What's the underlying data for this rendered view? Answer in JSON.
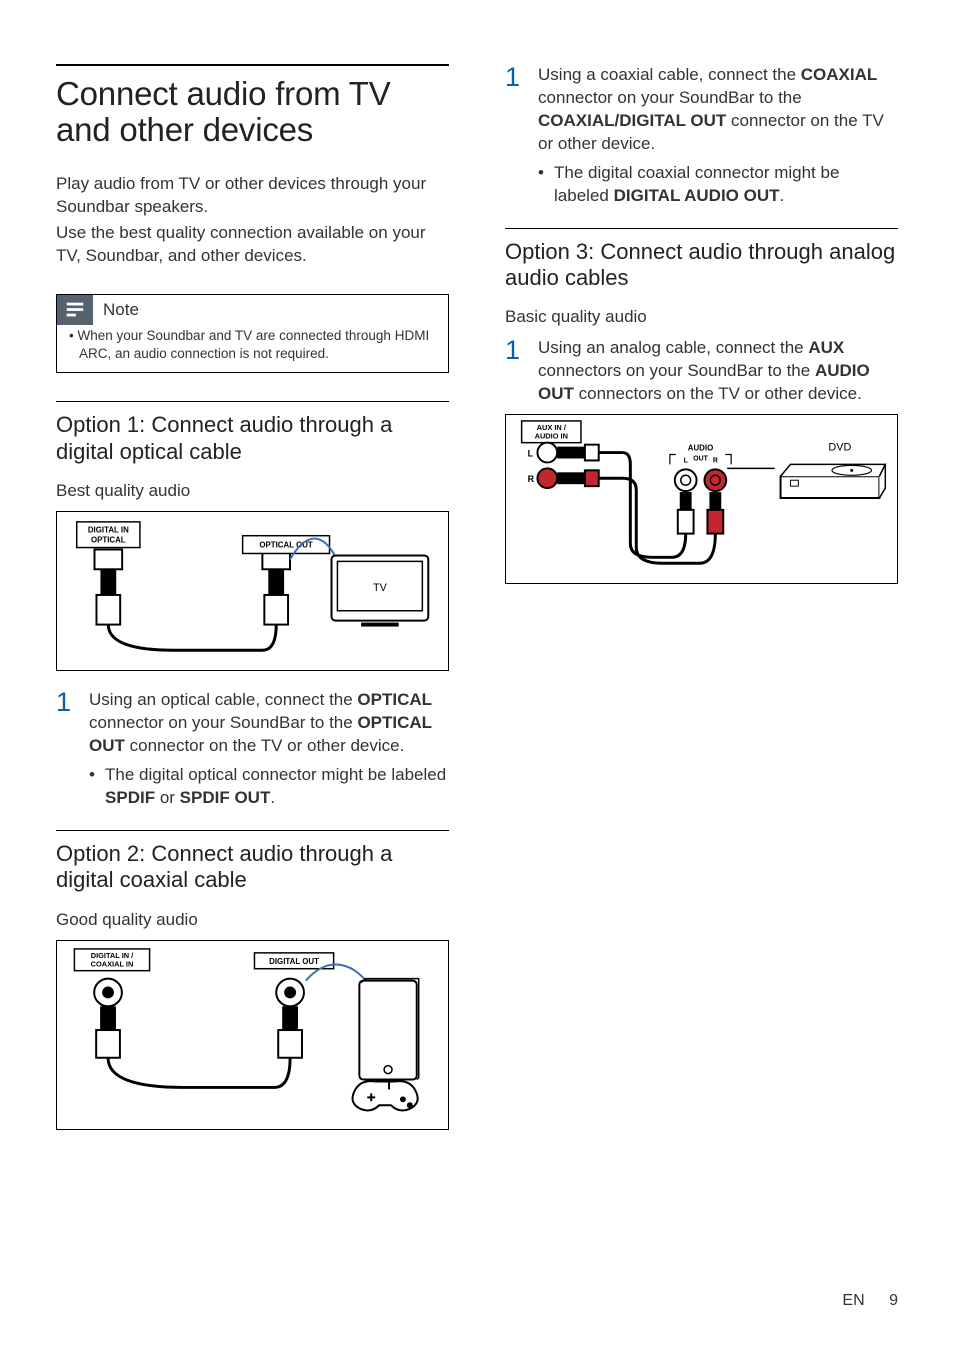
{
  "left": {
    "title": "Connect audio from TV and other devices",
    "intro1": "Play audio from TV or other devices through your Soundbar speakers.",
    "intro2": "Use the best quality connection available on your TV, Soundbar, and other devices.",
    "note": {
      "label": "Note",
      "item": "When your Soundbar and TV are connected through HDMI ARC, an audio connection is not required."
    },
    "opt1": {
      "heading": "Option 1: Connect audio through a digital optical cable",
      "quality": "Best quality audio",
      "diagram": {
        "label_in": "DIGITAL IN OPTICAL",
        "label_out": "OPTICAL OUT",
        "device": "TV"
      },
      "step1_a": "Using an optical cable, connect the ",
      "step1_b": "OPTICAL",
      "step1_c": " connector on your SoundBar to the ",
      "step1_d": "OPTICAL OUT",
      "step1_e": " connector on the TV or other device.",
      "sub_a": "The digital optical connector might be labeled ",
      "sub_b": "SPDIF",
      "sub_c": " or ",
      "sub_d": "SPDIF OUT",
      "sub_e": "."
    },
    "opt2": {
      "heading": "Option 2: Connect audio through a digital coaxial cable",
      "quality": "Good quality audio",
      "diagram": {
        "label_in": "DIGITAL IN / COAXIAL IN",
        "label_out": "DIGITAL OUT"
      }
    }
  },
  "right": {
    "opt2_step": {
      "num": "1",
      "a": "Using a coaxial cable, connect the ",
      "b": "COAXIAL",
      "c": " connector on your SoundBar to the ",
      "d": "COAXIAL/DIGITAL OUT",
      "e": " connector on the TV or other device.",
      "sub_a": "The digital coaxial connector might be labeled ",
      "sub_b": "DIGITAL AUDIO OUT",
      "sub_c": "."
    },
    "opt3": {
      "heading": "Option 3: Connect audio through analog audio cables",
      "quality": "Basic quality audio",
      "step1": {
        "num": "1",
        "a": "Using an analog cable, connect the ",
        "b": "AUX",
        "c": " connectors on your SoundBar to the ",
        "d": "AUDIO OUT",
        "e": " connectors on the TV or other device."
      },
      "diagram": {
        "label_in": "AUX IN / AUDIO IN",
        "l": "L",
        "r": "R",
        "audio_out": "AUDIO OUT",
        "device": "DVD"
      }
    }
  },
  "footer": {
    "lang": "EN",
    "page": "9"
  },
  "nums": {
    "one": "1"
  }
}
